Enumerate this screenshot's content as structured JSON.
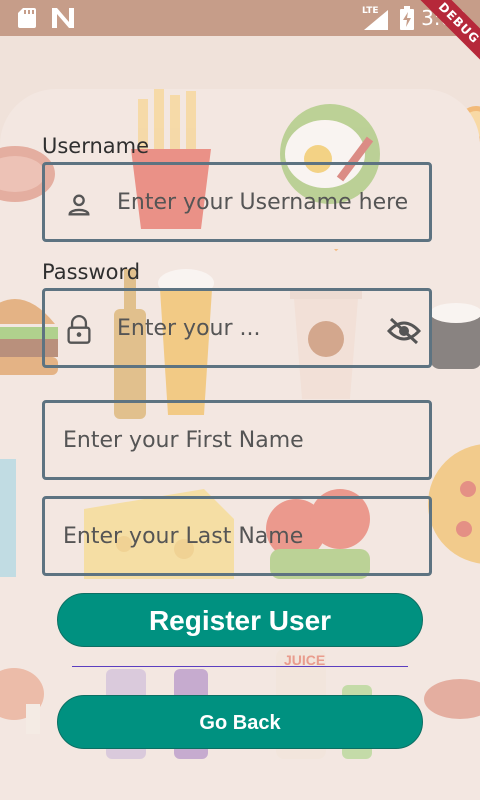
{
  "status_bar": {
    "time": "3:03",
    "network": "LTE",
    "icons": [
      "sd-card-icon",
      "n-logo-icon",
      "signal-icon",
      "battery-charging-icon"
    ]
  },
  "debug_banner": {
    "label": "DEBUG"
  },
  "form": {
    "username": {
      "label": "Username",
      "placeholder": "Enter your Username here",
      "icon": "person-icon"
    },
    "password": {
      "label": "Password",
      "placeholder": "Enter your ...",
      "icon": "lock-icon",
      "toggle_icon": "eye-off-icon"
    },
    "first_name": {
      "placeholder": "Enter your First Name"
    },
    "last_name": {
      "placeholder": "Enter your Last Name"
    },
    "register_label": "Register User",
    "back_label": "Go Back"
  },
  "colors": {
    "accent": "#009180",
    "field_border": "#5d7381",
    "divider": "#5b3ec0",
    "background": "#f3e7e1"
  },
  "background_decor_text": {
    "juice": "JUICE"
  }
}
